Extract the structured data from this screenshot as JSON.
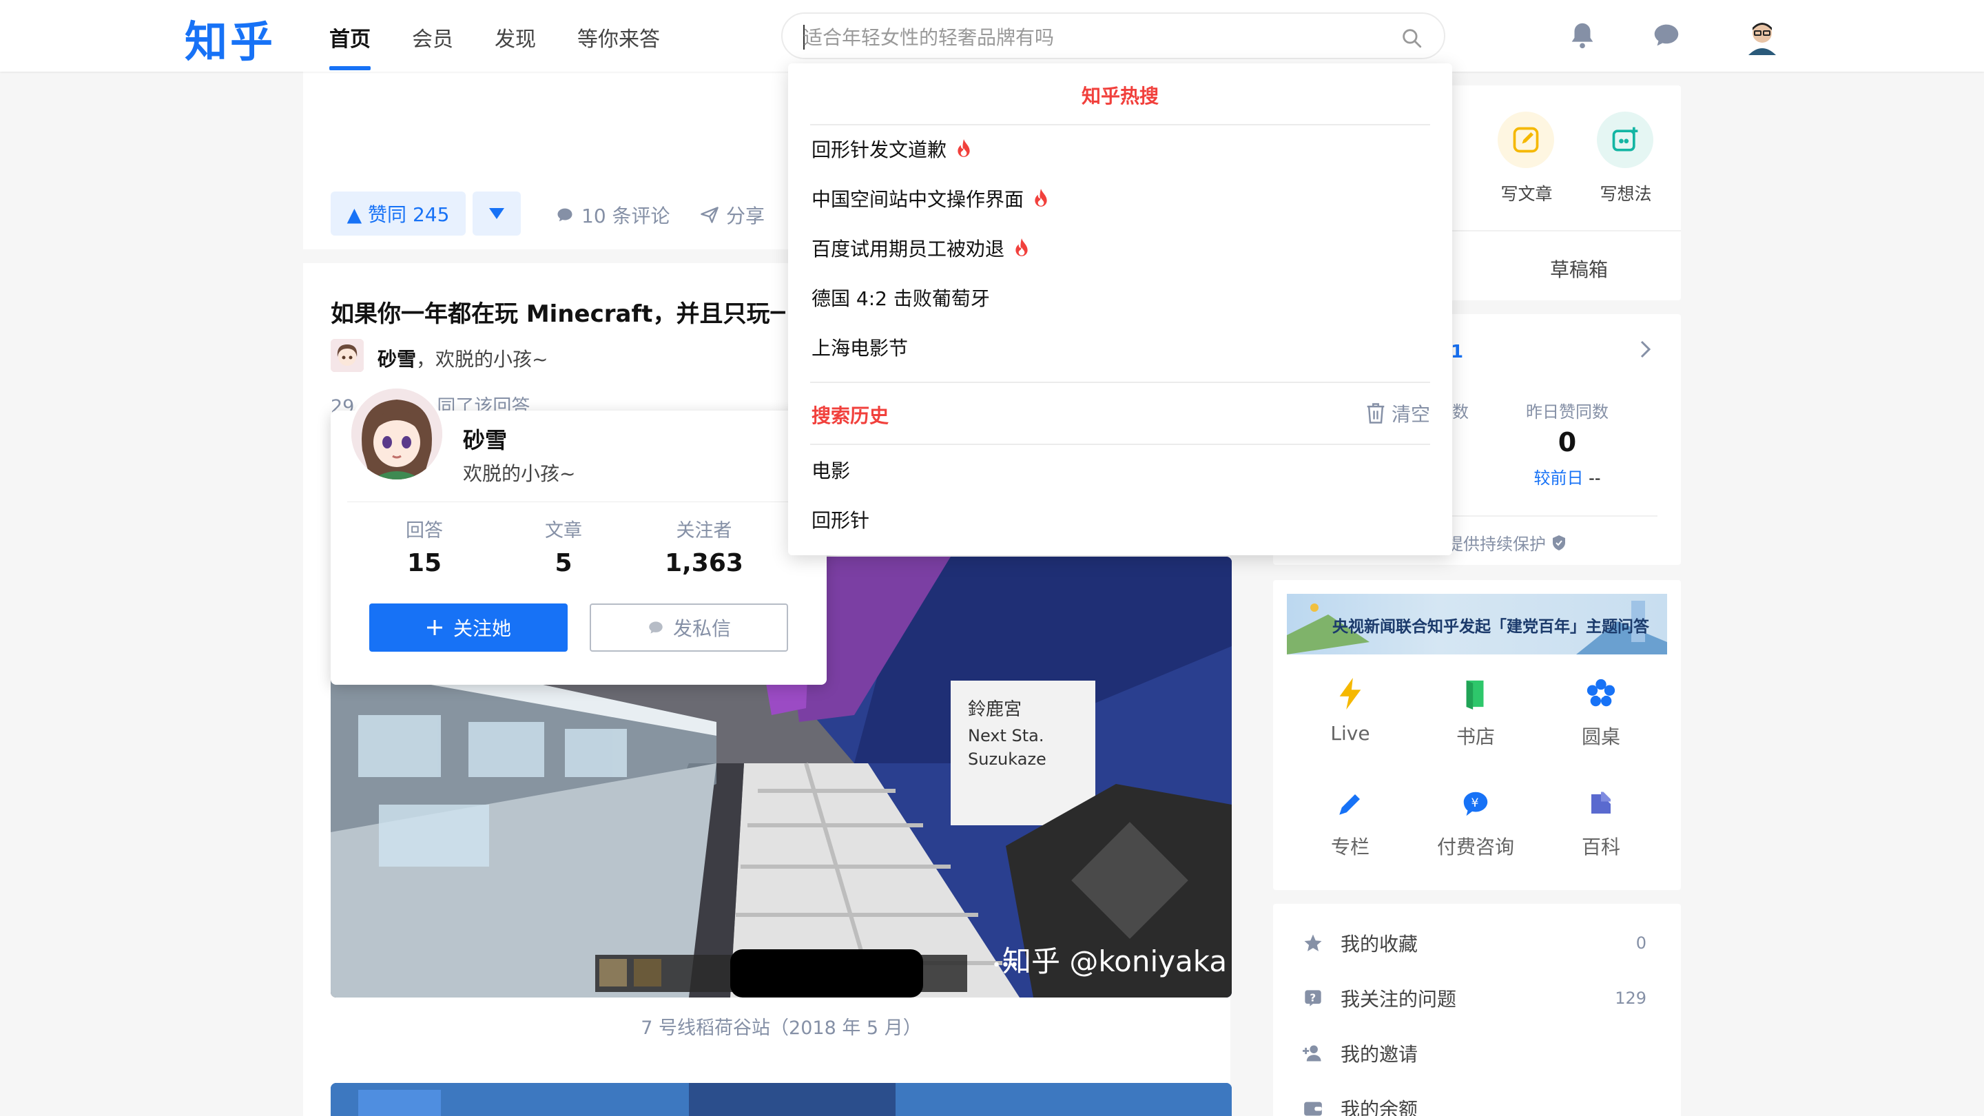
{
  "header": {
    "logo": "知乎",
    "nav": [
      "首页",
      "会员",
      "发现",
      "等你来答"
    ],
    "search_placeholder": "适合年轻女性的轻奢品牌有吗"
  },
  "answer_actions": {
    "upvote": "▲ 赞同 245",
    "comments": "10 条评论",
    "share": "分享"
  },
  "question": {
    "title": "如果你一年都在玩 Minecraft，并且只玩一",
    "author_name": "砂雪",
    "author_bio": "欢脱的小孩~",
    "vote_meta_prefix": "29",
    "vote_meta_suffix": "同了该回答"
  },
  "image": {
    "watermark": "知乎 @koniyaka",
    "caption": "7 号线稻荷谷站（2018 年 5 月）",
    "sign_text": [
      "鈴鹿宮",
      "Next Sta.",
      "Suzukaze"
    ]
  },
  "hovercard": {
    "name": "砂雪",
    "bio": "欢脱的小孩~",
    "stats": [
      {
        "label": "回答",
        "value": "15"
      },
      {
        "label": "文章",
        "value": "5"
      },
      {
        "label": "关注者",
        "value": "1,363"
      }
    ],
    "follow_label": "关注她",
    "message_label": "发私信"
  },
  "dropdown": {
    "hot_title": "知乎热搜",
    "hot_items": [
      {
        "text": "回形针发文道歉",
        "hot": true
      },
      {
        "text": "中国空间站中文操作界面",
        "hot": true
      },
      {
        "text": "百度试用期员工被劝退",
        "hot": true
      },
      {
        "text": "德国 4:2 击败葡萄牙",
        "hot": false
      },
      {
        "text": "上海电影节",
        "hot": false
      }
    ],
    "history_title": "搜索历史",
    "clear_label": "清空",
    "history_items": [
      "电影",
      "回形针"
    ]
  },
  "sidebar": {
    "create": [
      {
        "label": "写文章"
      },
      {
        "label": "写想法"
      }
    ],
    "drafts": "草稿箱",
    "stats_number": "1",
    "yesterday_title": "昨日赞同数",
    "yesterday_value": "0",
    "yesterday_compare_label": "较前日",
    "yesterday_compare_value": "--",
    "partial_label": "数",
    "protection": "提供持续保护",
    "banner": "央视新闻联合知乎发起「建党百年」主题问答",
    "grid": [
      "Live",
      "书店",
      "圆桌",
      "专栏",
      "付费咨询",
      "百科"
    ],
    "list": [
      {
        "label": "我的收藏",
        "count": "0"
      },
      {
        "label": "我关注的问题",
        "count": "129"
      },
      {
        "label": "我的邀请",
        "count": ""
      },
      {
        "label": "我的余额",
        "count": ""
      }
    ]
  },
  "colors": {
    "brand": "#1772f6",
    "hot_red": "#f1403c"
  }
}
